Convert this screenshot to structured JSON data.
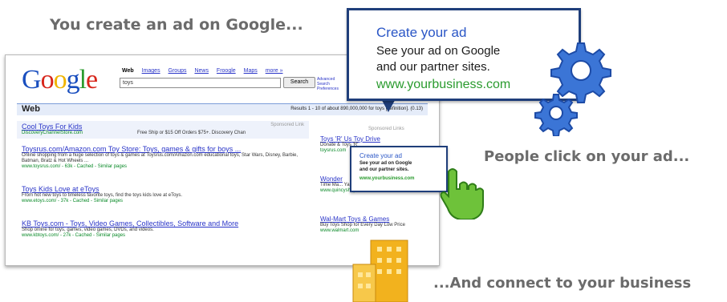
{
  "captions": {
    "create": "You create an ad on Google...",
    "click": "People click on your ad...",
    "connect": "...And connect to your business"
  },
  "callout": {
    "title": "Create your ad",
    "line1": "See your ad on Google",
    "line2": "and our partner sites.",
    "url": "www.yourbusiness.com"
  },
  "callout_small": {
    "title": "Create your ad",
    "line1": "See your ad on Google",
    "line2": "and our partner sites.",
    "url": "www.yourbusiness.com"
  },
  "serp": {
    "nav": [
      "Web",
      "Images",
      "Groups",
      "News",
      "Froogle",
      "Maps",
      "more »"
    ],
    "query": "toys",
    "search_button": "Search",
    "advanced": "Advanced Search Preferences",
    "section": "Web",
    "results_info": "Results 1 - 10 of about 890,000,000 for toys [definition]. (0.13)",
    "top_ad": {
      "title": "Cool Toys For Kids",
      "url": "DiscoveryChannelStore.com",
      "desc": "Free Ship or $15 Off Orders $75+. Discovery Chan",
      "label": "Sponsored Link"
    },
    "results": [
      {
        "title": "Toysrus.com/Amazon.com Toy Store: Toys, games & gifts for boys ...",
        "desc": "Online shopping from a huge selection of toys & games at Toysrus.com/Amazon.com educational toys, Star Wars, Disney, Barbie, Batman, Bratz & Hot Wheels ...",
        "url": "www.toysrus.com/ - 63k - Cached - Similar pages"
      },
      {
        "title": "Toys Kids Love at eToys",
        "desc": "From hot new toys to timeless favorite toys, find the toys kids love at eToys.",
        "url": "www.etoys.com/ - 37k - Cached - Similar pages"
      },
      {
        "title": "KB Toys.com - Toys, Video Games, Collectibles, Software and More",
        "desc": "Shop online for toys, games, video games, DVDs, and videos.",
        "url": "www.kbtoys.com/ - 27k - Cached - Similar pages"
      }
    ],
    "sponsored_label": "Sponsored Links",
    "side_ads": [
      {
        "title": "Toys 'R' Us Toy Drive",
        "desc": "Donate & Toys 'R'",
        "url": "toysrus.com"
      },
      {
        "title": "Wonder",
        "desc": "Time Ma... Yahoo! Toy",
        "url": "www.quincyshop.c"
      },
      {
        "title": "Wal-Mart Toys & Games",
        "desc": "Buy Toys Shop for Every Day Low Price",
        "url": "www.walmart.com"
      }
    ]
  }
}
